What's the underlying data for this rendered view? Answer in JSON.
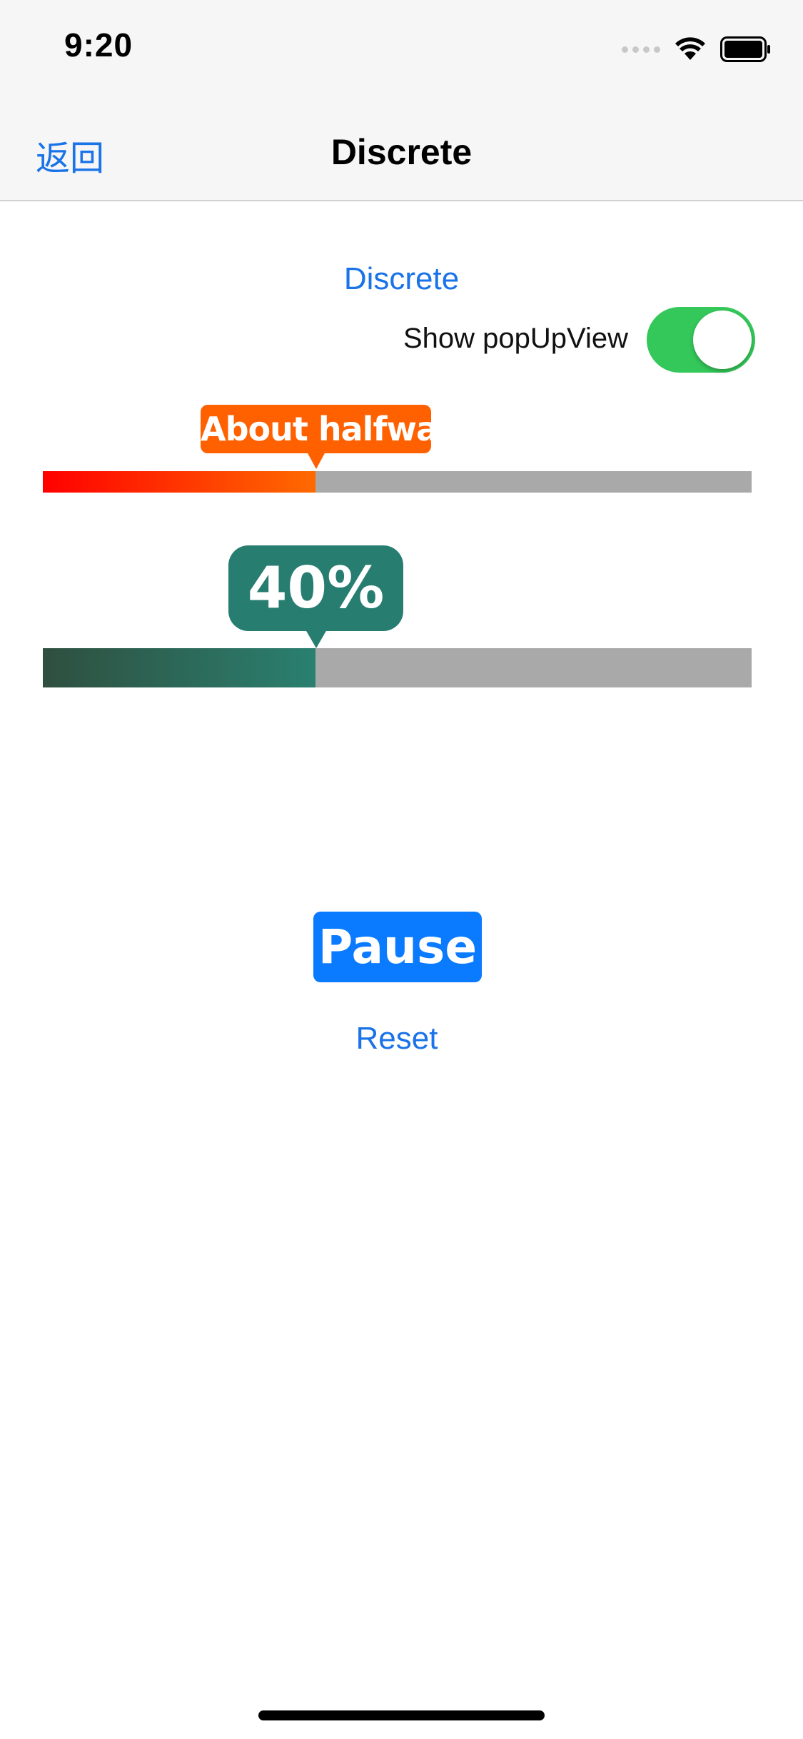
{
  "status_bar": {
    "time": "9:20",
    "icons": [
      "cellular-signal-icon",
      "wifi-icon",
      "battery-icon"
    ]
  },
  "nav_bar": {
    "back_label": "返回",
    "title": "Discrete"
  },
  "content": {
    "discrete_label": "Discrete",
    "toggle": {
      "label": "Show popUpView",
      "on": true,
      "color": "#34c759"
    },
    "slider1": {
      "popup_text": "About halfway",
      "value_fraction": 0.385,
      "fill_colors": [
        "#ff0000",
        "#ff6a00"
      ],
      "popup_color": "#ff6100"
    },
    "slider2": {
      "popup_text": "40%",
      "value_fraction": 0.385,
      "fill_colors": [
        "#2f4f3f",
        "#2a8070"
      ],
      "popup_color": "#277d70"
    },
    "pause_label": "Pause",
    "reset_label": "Reset"
  },
  "colors": {
    "accent": "#1a73e8",
    "button_blue": "#0a7aff",
    "track_gray": "#a9a9a9"
  }
}
